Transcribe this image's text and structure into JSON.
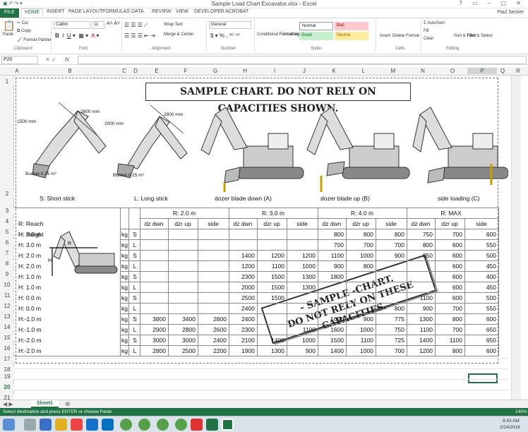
{
  "window": {
    "title": "Sample Load Chart Excavator.xlsx - Excel",
    "user": "Paul Secker"
  },
  "ribbon_tabs": [
    "FILE",
    "HOME",
    "INSERT",
    "PAGE LAYOUT",
    "FORMULAS",
    "DATA",
    "REVIEW",
    "VIEW",
    "DEVELOPER",
    "ACROBAT"
  ],
  "ribbon": {
    "clipboard": {
      "paste": "Paste",
      "cut": "Cut",
      "copy": "Copy",
      "format_painter": "Format Painter",
      "label": "Clipboard"
    },
    "font": {
      "name": "Calibri",
      "size": "11",
      "label": "Font"
    },
    "alignment": {
      "wrap": "Wrap Text",
      "merge": "Merge & Center",
      "label": "Alignment"
    },
    "number": {
      "format": "General",
      "label": "Number"
    },
    "styles": {
      "cond": "Conditional Formatting",
      "table": "Format as Table",
      "normal": "Normal",
      "bad": "Bad",
      "good": "Good",
      "neutral": "Neutral",
      "label": "Styles"
    },
    "cells": {
      "insert": "Insert",
      "delete": "Delete",
      "format": "Format",
      "label": "Cells"
    },
    "editing": {
      "autosum": "AutoSum",
      "fill": "Fill",
      "clear": "Clear",
      "sort": "Sort & Filter",
      "find": "Find & Select",
      "label": "Editing"
    }
  },
  "formula_bar": {
    "name_box": "P20",
    "fx": "fx",
    "value": ""
  },
  "columns": [
    "A",
    "B",
    "C",
    "D",
    "E",
    "F",
    "G",
    "H",
    "I",
    "J",
    "K",
    "L",
    "M",
    "N",
    "O",
    "P",
    "Q",
    "R"
  ],
  "rows": [
    "1",
    "2",
    "3",
    "4",
    "5",
    "6",
    "7",
    "8",
    "9",
    "10",
    "11",
    "12",
    "13",
    "14",
    "15",
    "16",
    "17",
    "18",
    "19",
    "20",
    "21",
    "22"
  ],
  "chart_banner": "SAMPLE CHART. DO NOT RELY ON CAPACITIES SHOWN.",
  "diagram_labels": {
    "short_len": "2800 mm",
    "short_h": "1500 mm",
    "short_bucket": "Bucket 0.25 m³",
    "long_len": "2800 mm",
    "long_h": "2000 mm",
    "long_bucket": "Bucket 0.25 m³"
  },
  "captions": {
    "short": "S: Short stick",
    "long": "L: Long stick",
    "down": "dozer blade down (A)",
    "up": "dozer blade up (B)",
    "side": "side loading (C)"
  },
  "table": {
    "reach_label": "R: Reach",
    "height_label": "H: Height",
    "reach_groups": [
      "R: 2.0 m",
      "R: 3.0 m",
      "R: 4.0 m",
      "R: MAX"
    ],
    "sub_headers": [
      "dz dwn",
      "dzr up",
      "side"
    ],
    "rows": [
      {
        "h": "H:  3.0 m",
        "u": "kg",
        "s": "S",
        "v": [
          "",
          "",
          "",
          "",
          "",
          "",
          "800",
          "800",
          "800",
          "750",
          "700",
          "600"
        ]
      },
      {
        "h": "H:  3.0 m",
        "u": "kg",
        "s": "L",
        "v": [
          "",
          "",
          "",
          "",
          "",
          "",
          "700",
          "700",
          "700",
          "800",
          "600",
          "550"
        ]
      },
      {
        "h": "H:  2.0 m",
        "u": "kg",
        "s": "S",
        "v": [
          "",
          "",
          "",
          "1400",
          "1200",
          "1200",
          "1100",
          "1000",
          "900",
          "850",
          "600",
          "500"
        ]
      },
      {
        "h": "H:  2.0 m",
        "u": "kg",
        "s": "L",
        "v": [
          "",
          "",
          "",
          "1200",
          "1100",
          "1000",
          "900",
          "800",
          "",
          "",
          "600",
          "450"
        ]
      },
      {
        "h": "H:  1.0 m",
        "u": "kg",
        "s": "S",
        "v": [
          "",
          "",
          "",
          "2300",
          "1500",
          "1300",
          "1800",
          "",
          "",
          "",
          "600",
          "400"
        ]
      },
      {
        "h": "H:  1.0 m",
        "u": "kg",
        "s": "L",
        "v": [
          "",
          "",
          "",
          "2000",
          "1500",
          "1300",
          "",
          "",
          "",
          "",
          "600",
          "450"
        ]
      },
      {
        "h": "H:  0.0 m",
        "u": "kg",
        "s": "S",
        "v": [
          "",
          "",
          "",
          "2500",
          "1500",
          "",
          "",
          "",
          "",
          "1100",
          "600",
          "500"
        ]
      },
      {
        "h": "H:  0.0 m",
        "u": "kg",
        "s": "L",
        "v": [
          "",
          "",
          "",
          "2400",
          "",
          "",
          "",
          "",
          "800",
          "900",
          "700",
          "550"
        ]
      },
      {
        "h": "H:-1.0 m",
        "u": "kg",
        "s": "S",
        "v": [
          "3800",
          "3400",
          "2800",
          "2400",
          "",
          "",
          "1600",
          "900",
          "775",
          "1300",
          "800",
          "600"
        ]
      },
      {
        "h": "H:-1.0 m",
        "u": "kg",
        "s": "L",
        "v": [
          "2900",
          "2800",
          "2600",
          "2300",
          "",
          "1100",
          "1600",
          "1000",
          "750",
          "1100",
          "700",
          "650"
        ]
      },
      {
        "h": "H:-2.0 m",
        "u": "kg",
        "s": "S",
        "v": [
          "3000",
          "3000",
          "2400",
          "2100",
          "1400",
          "1000",
          "1500",
          "1100",
          "725",
          "1400",
          "1100",
          "650"
        ]
      },
      {
        "h": "H:-2.0 m",
        "u": "kg",
        "s": "L",
        "v": [
          "2800",
          "2500",
          "2200",
          "1900",
          "1300",
          "900",
          "1400",
          "1000",
          "700",
          "1200",
          "800",
          "600"
        ]
      }
    ]
  },
  "stamp": {
    "line1": "- SAMPLE -CHART.",
    "line2": "DO NOT RELY ON THESE CAPACITIES."
  },
  "sheet_tab": "Sheet1",
  "status_text": "Select destination and press ENTER or choose Paste",
  "zoom": "140%",
  "clock": {
    "time": "9:43 AM",
    "date": "2/24/2016"
  }
}
